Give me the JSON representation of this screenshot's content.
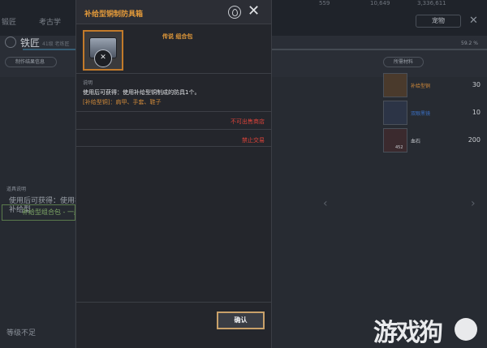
{
  "background": {
    "tabs": [
      "锻匠",
      "考古学"
    ],
    "stats": [
      "559",
      "10,649",
      "3,336,611"
    ],
    "pet_button": "宠物",
    "smith_title": "铁匠",
    "smith_sub": "41级 老练匠",
    "progress_pct": "59.2 %",
    "make_info_button": "制作结果信息",
    "materials_header": "所需材料",
    "materials": [
      {
        "name": "补给型铜",
        "count": "30",
        "color": "#d28a3a"
      },
      {
        "name": "双眼黑镜",
        "count": "10",
        "color": "#3a6ec0"
      },
      {
        "name": "血石",
        "count": "200",
        "color": "#c9ccd1",
        "sub": "452"
      }
    ],
    "desc_title": "道具说明",
    "desc_line1": "使用后可获得：使用补",
    "desc_line2": "补给型",
    "green_row": "补给型组合包 - 一般",
    "level_text": "等级不足",
    "watermark": "游戏狗"
  },
  "dialog": {
    "title": "补给型铜制防具箱",
    "rarity": "传说 组合包",
    "badge_glyph": "✕",
    "desc_label": "说明",
    "desc_text": "使用后可获得：使用补给型铜制成的防具1个。",
    "desc_sub": "[补给型铜]：肩甲、手套、鞋子",
    "no_sell": "不可出售商店",
    "no_trade": "禁止交易",
    "confirm": "确认"
  }
}
